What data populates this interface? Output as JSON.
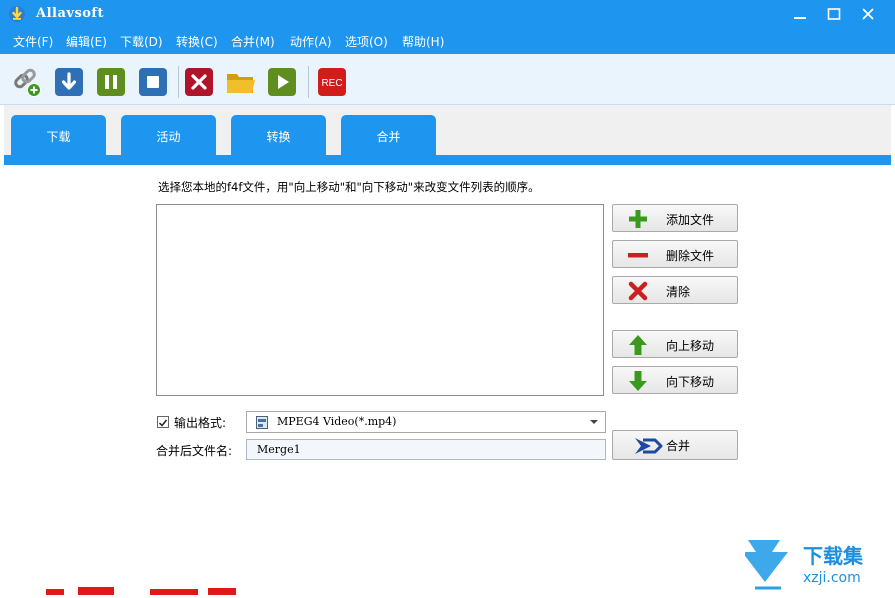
{
  "window": {
    "title": "Allavsoft"
  },
  "menu": [
    "文件(F)",
    "编辑(E)",
    "下载(D)",
    "转换(C)",
    "合并(M)",
    "动作(A)",
    "选项(O)",
    "帮助(H)"
  ],
  "toolbar": {
    "icons": [
      "link-add-icon",
      "download-icon",
      "pause-icon",
      "stop-icon",
      "delete-icon",
      "folder-icon",
      "play-icon",
      "rec-icon"
    ],
    "rec_label": "REC"
  },
  "tabs": [
    "下载",
    "活动",
    "转换",
    "合并"
  ],
  "merge": {
    "instruction": "选择您本地的f4f文件，用\"向上移动\"和\"向下移动\"来改变文件列表的顺序。",
    "buttons": {
      "add": "添加文件",
      "remove": "删除文件",
      "clear": "清除",
      "up": "向上移动",
      "down": "向下移动",
      "merge": "合并"
    },
    "output_format_label": "输出格式:",
    "output_format_checked": true,
    "output_format_value": "MPEG4 Video(*.mp4)",
    "filename_label": "合并后文件名:",
    "filename_value": "Merge1"
  },
  "watermark": {
    "title": "下载集",
    "url": "xzji.com"
  },
  "colors": {
    "accent": "#1e95ee",
    "green": "#3a9a1e",
    "red": "#cc1f1f",
    "navy": "#1c4aa0"
  }
}
